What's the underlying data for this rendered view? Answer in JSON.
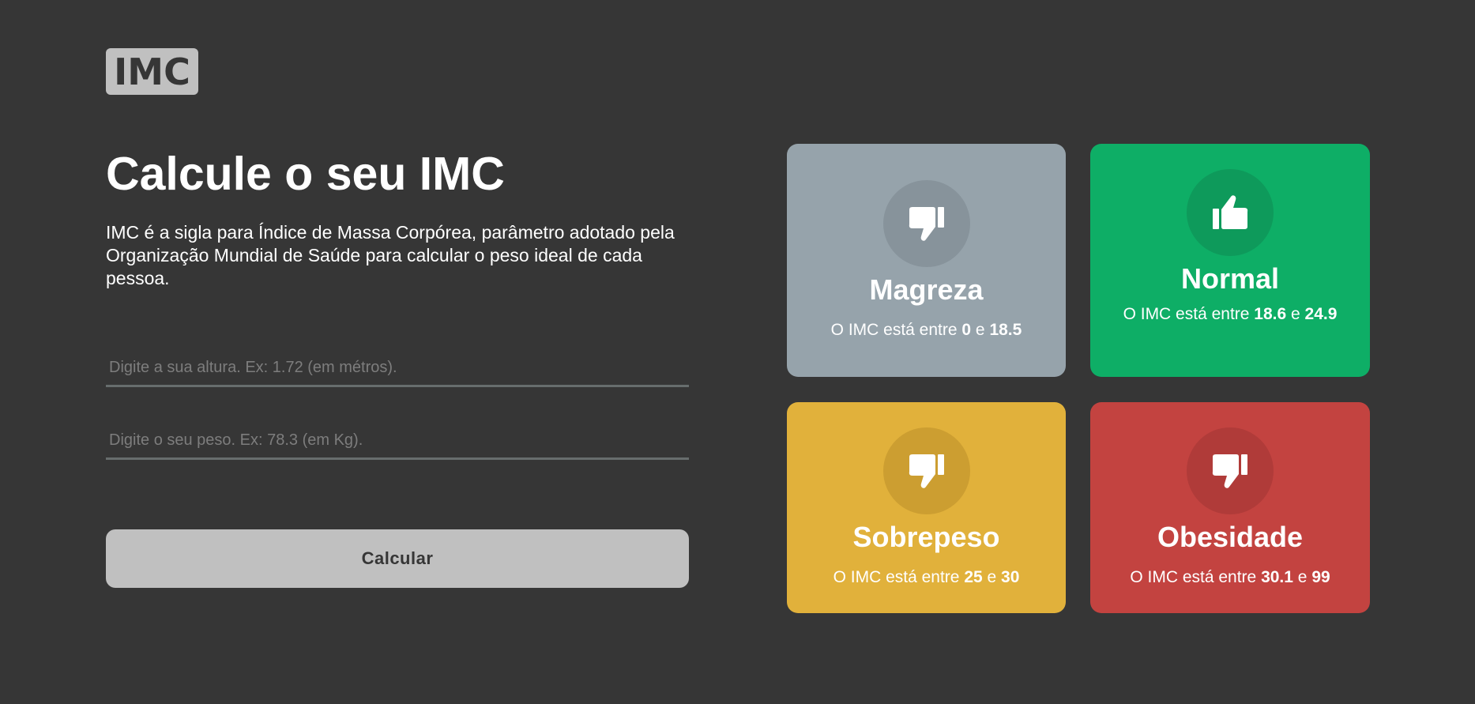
{
  "logo": {
    "text": "IMC"
  },
  "main": {
    "title": "Calcule o seu IMC",
    "description": "IMC é a sigla para Índice de Massa Corpórea, parâmetro adotado pela Organização Mundial de Saúde para calcular o peso ideal de cada pessoa."
  },
  "form": {
    "height_placeholder": "Digite a sua altura. Ex: 1.72 (em métros).",
    "height_value": "",
    "weight_placeholder": "Digite o seu peso. Ex: 78.3 (em Kg).",
    "weight_value": "",
    "submit_label": "Calcular"
  },
  "range_prefix": "O IMC está entre",
  "range_joiner": "e",
  "cards": [
    {
      "title": "Magreza",
      "min": "0",
      "max": "18.5",
      "icon": "thumbs-down-icon",
      "color": "#96a3ab"
    },
    {
      "title": "Normal",
      "min": "18.6",
      "max": "24.9",
      "icon": "thumbs-up-icon",
      "color": "#0eae66"
    },
    {
      "title": "Sobrepeso",
      "min": "25",
      "max": "30",
      "icon": "thumbs-down-icon",
      "color": "#e1b13b"
    },
    {
      "title": "Obesidade",
      "min": "30.1",
      "max": "99",
      "icon": "thumbs-down-icon",
      "color": "#c34340"
    }
  ],
  "colors": {
    "background": "#363636",
    "button": "#c0c0c0",
    "input_border": "#676d6d"
  }
}
